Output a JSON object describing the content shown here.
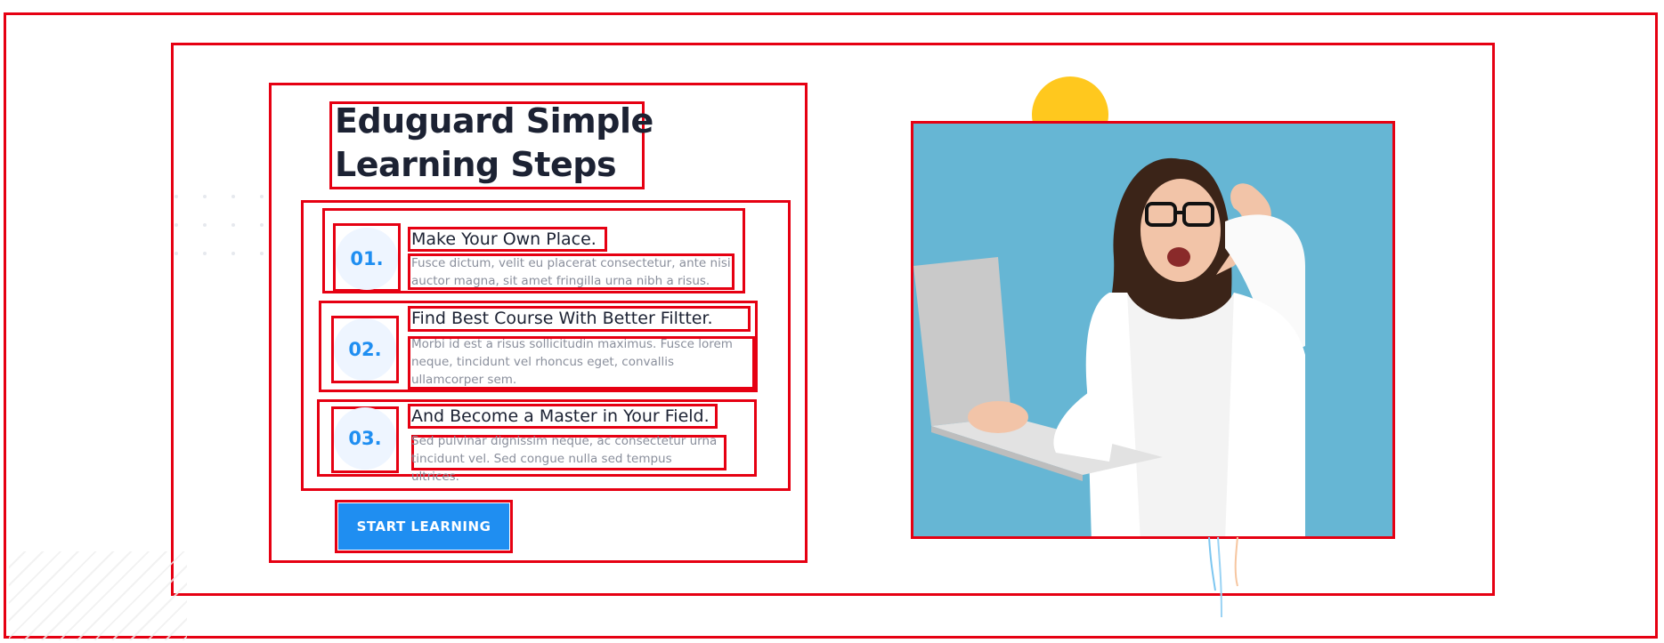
{
  "heading": {
    "line1": "Eduguard Simple",
    "line2": "Learning Steps"
  },
  "steps": [
    {
      "number": "01.",
      "title": "Make Your Own Place.",
      "desc_line1": "Fusce dictum, velit eu placerat consectetur, ante nisi",
      "desc_line2": "auctor magna, sit amet fringilla urna nibh a risus."
    },
    {
      "number": "02.",
      "title": "Find Best Course With Better Filtter.",
      "desc_line1": "Morbi id est a risus sollicitudin maximus. Fusce lorem",
      "desc_line2": "neque, tincidunt vel rhoncus eget, convallis",
      "desc_line3": "ullamcorper sem."
    },
    {
      "number": "03.",
      "title": "And Become a Master in Your Field.",
      "desc_line1": "Sed pulvinar dignissim neque, ac consectetur urna",
      "desc_line2": "tincidunt vel. Sed congue nulla sed tempus ultrices."
    }
  ],
  "cta": {
    "label": "START LEARNING"
  },
  "colors": {
    "accent": "#1f8ef1",
    "heading": "#1c2233",
    "muted": "#8a8f9c",
    "highlight": "#ffc81e",
    "photo_bg": "#66b6d4"
  },
  "icons": {
    "decor_circle": "yellow-circle",
    "decor_dots": "dot-grid",
    "decor_stripes": "diagonal-stripes"
  }
}
